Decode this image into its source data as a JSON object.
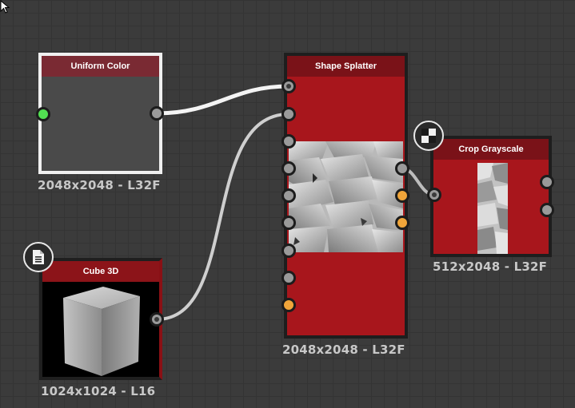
{
  "nodes": {
    "uniform_color": {
      "title": "Uniform Color",
      "resolution": "2048x2048 - L32F"
    },
    "cube_3d": {
      "title": "Cube 3D",
      "resolution": "1024x1024 - L16",
      "badge_icon": "document-icon"
    },
    "shape_splatter": {
      "title": "Shape Splatter",
      "resolution": "2048x2048 - L32F"
    },
    "crop_grayscale": {
      "title": "Crop Grayscale",
      "resolution": "512x2048 - L32F",
      "badge_icon": "checker-icon"
    }
  },
  "colors": {
    "canvas": "#3b3b3b",
    "node_red": "#a8161c",
    "title_red": "#7a1218",
    "port_gray": "#9a9a9a",
    "port_orange": "#f0a53a",
    "port_green": "#52e052",
    "wire": "#f2f2f2"
  }
}
